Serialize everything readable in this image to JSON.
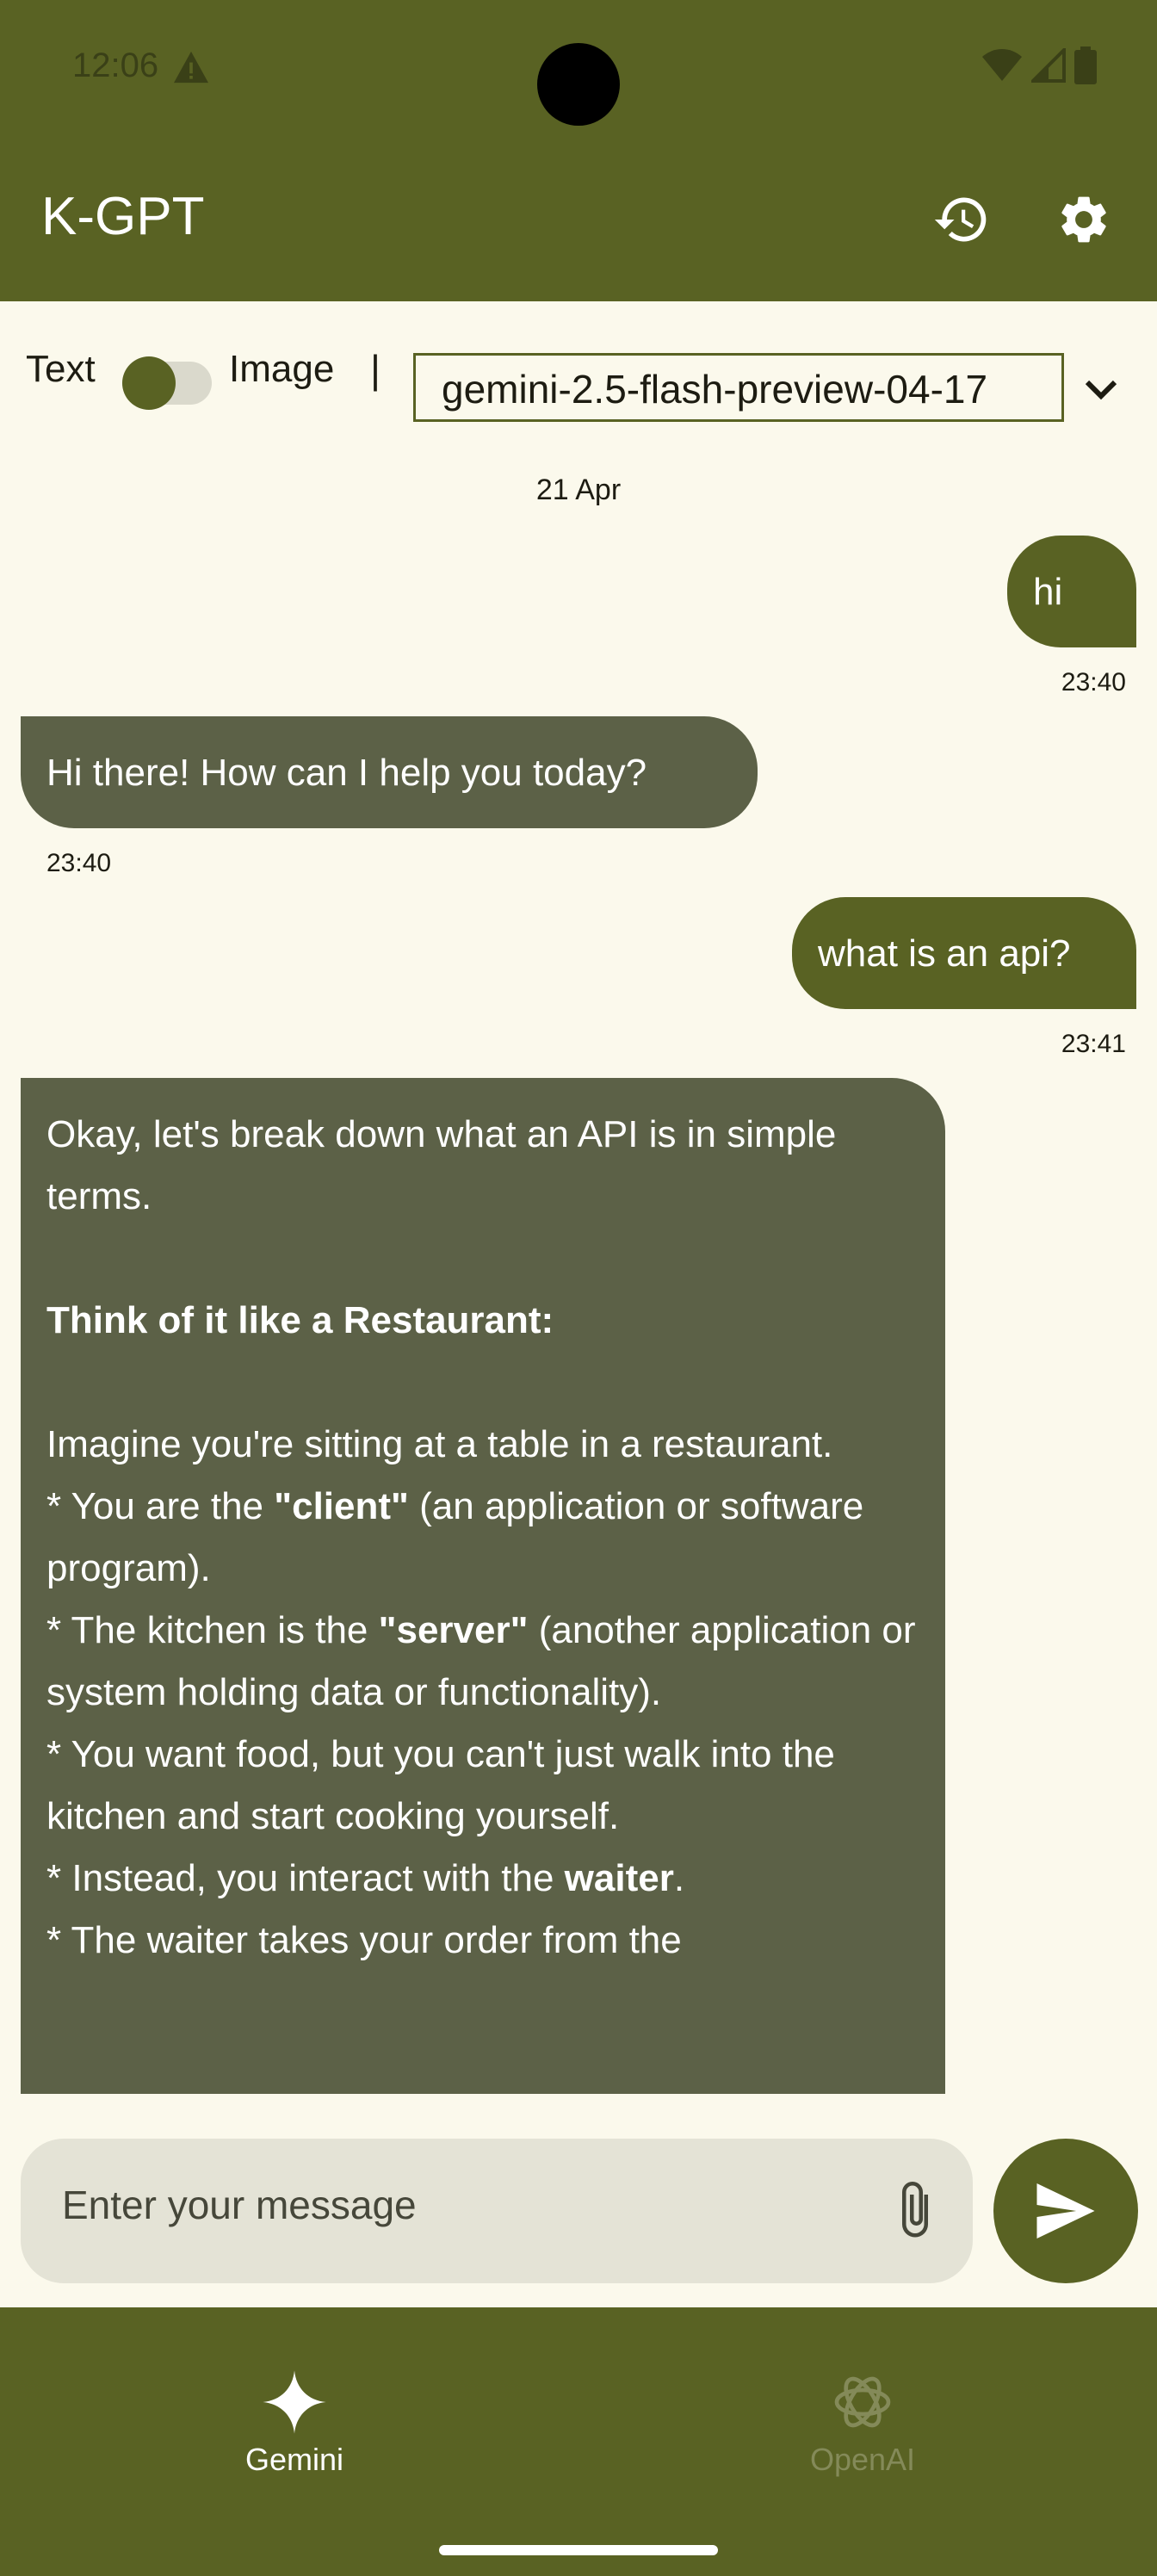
{
  "status_bar": {
    "time": "12:06"
  },
  "app_bar": {
    "title": "K-GPT"
  },
  "mode": {
    "text_label": "Text",
    "image_label": "Image",
    "separator": "|",
    "toggle_on": false
  },
  "model_selector": {
    "value": "gemini-2.5-flash-preview-04-17"
  },
  "date_divider": "21 Apr",
  "messages": [
    {
      "role": "user",
      "text": "hi",
      "time": "23:40"
    },
    {
      "role": "bot",
      "text": "Hi there! How can I help you today?",
      "time": "23:40"
    },
    {
      "role": "user",
      "text": "what is an api?",
      "time": "23:41"
    },
    {
      "role": "bot",
      "intro": "Okay, let's break down what an API is in simple terms.",
      "heading": "Think of it like a Restaurant:",
      "para": "Imagine you're sitting at a table in a restaurant.",
      "b1_pre": "*   You are the ",
      "b1_bold": "\"client\"",
      "b1_post": " (an application or software program).",
      "b2_pre": "*   The kitchen is the ",
      "b2_bold": "\"server\"",
      "b2_post": " (another application or system holding data or functionality).",
      "b3": "*   You want food, but you can't just walk into the kitchen and start cooking yourself.",
      "b4_pre": "*   Instead, you interact with the ",
      "b4_bold": "waiter",
      "b4_post": ".",
      "b5": "*   The waiter takes your order from the"
    }
  ],
  "composer": {
    "placeholder": "Enter your message"
  },
  "bottom_nav": [
    {
      "label": "Gemini",
      "active": true
    },
    {
      "label": "OpenAI",
      "active": false
    }
  ],
  "colors": {
    "primary": "#596223",
    "surface": "#fbf9ec",
    "bot_bubble": "#5c6147",
    "input_bg": "#e4e3d6"
  }
}
